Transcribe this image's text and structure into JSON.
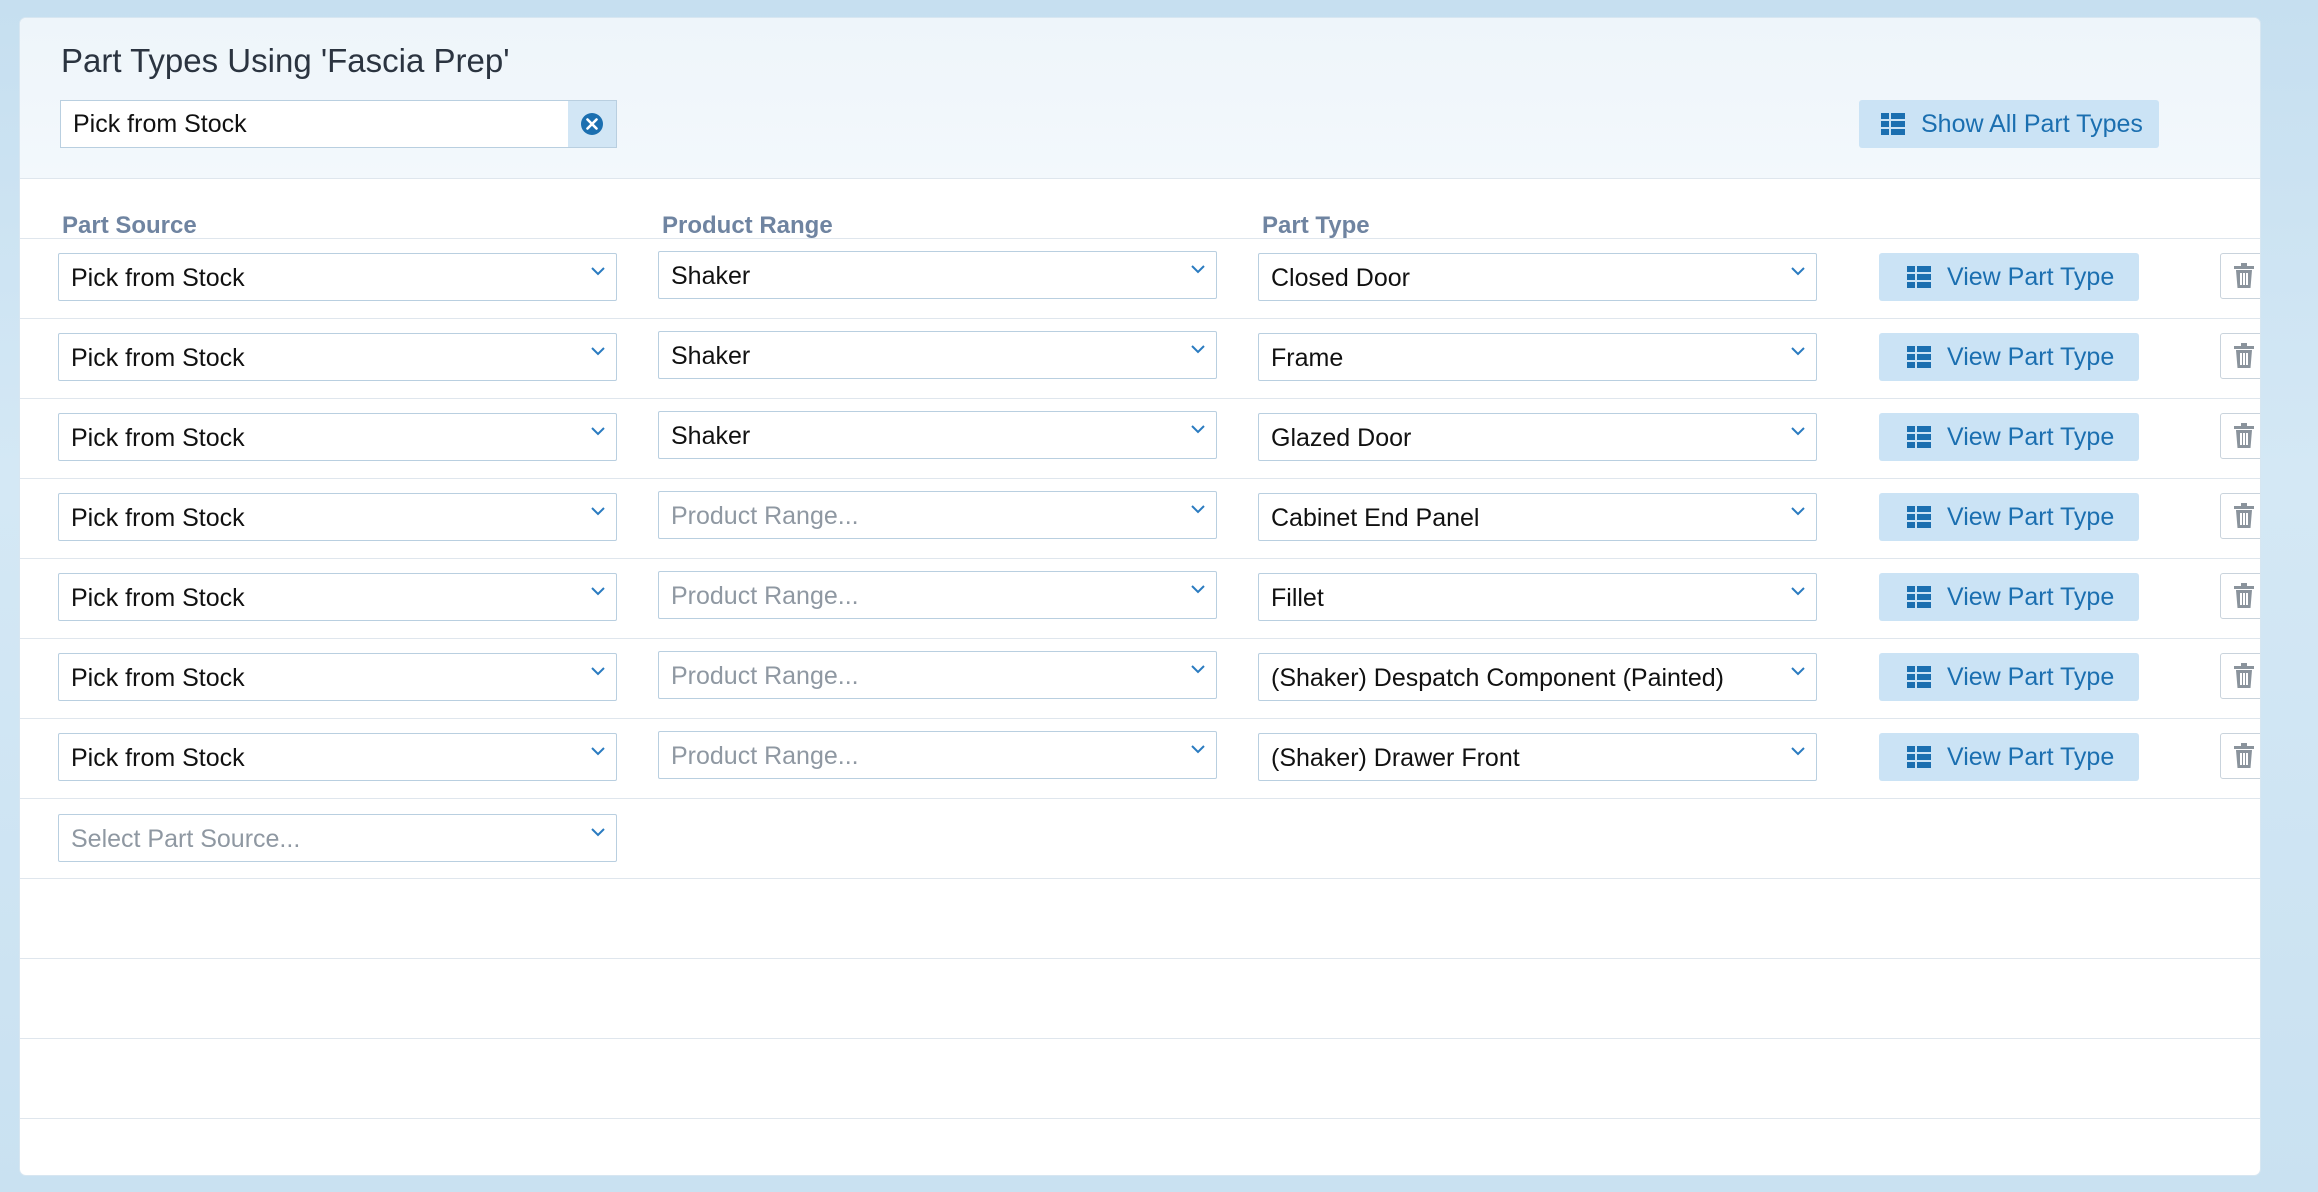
{
  "header": {
    "title": "Part Types Using 'Fascia Prep'",
    "filter_value": "Pick from Stock",
    "show_all_label": "Show All Part Types"
  },
  "columns": {
    "part_source": "Part Source",
    "product_range": "Product Range",
    "part_type": "Part Type"
  },
  "rows": [
    {
      "part_source": "Pick from Stock",
      "product_range": "Shaker",
      "part_type": "Closed Door",
      "action": "View Part Type"
    },
    {
      "part_source": "Pick from Stock",
      "product_range": "Shaker",
      "part_type": "Frame",
      "action": "View Part Type"
    },
    {
      "part_source": "Pick from Stock",
      "product_range": "Shaker",
      "part_type": "Glazed Door",
      "action": "View Part Type"
    },
    {
      "part_source": "Pick from Stock",
      "product_range": "Product Range...",
      "part_type": "Cabinet End Panel",
      "action": "View Part Type"
    },
    {
      "part_source": "Pick from Stock",
      "product_range": "Product Range...",
      "part_type": "Fillet",
      "action": "View Part Type"
    },
    {
      "part_source": "Pick from Stock",
      "product_range": "Product Range...",
      "part_type": "(Shaker) Despatch Component (Painted)",
      "action": "View Part Type"
    },
    {
      "part_source": "Pick from Stock",
      "product_range": "Product Range...",
      "part_type": "(Shaker) Drawer Front",
      "action": "View Part Type"
    }
  ],
  "new_row": {
    "part_source_placeholder": "Select Part Source..."
  },
  "colors": {
    "accent": "#1b6fb0",
    "button_bg": "#cbe3f5",
    "header_text": "#6f84a1"
  },
  "icons": [
    "clear-icon",
    "grid-icon",
    "chevron-down-icon",
    "trash-icon",
    "scroll-up-icon",
    "scroll-down-icon"
  ]
}
